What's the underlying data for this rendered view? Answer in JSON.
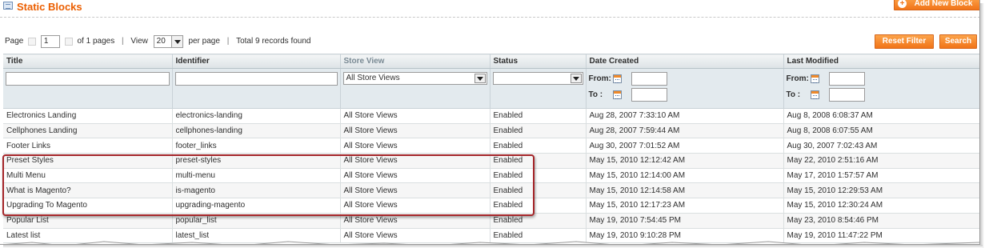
{
  "header": {
    "title": "Static Blocks",
    "add_button_label": "Add New Block"
  },
  "pager": {
    "page_label": "Page",
    "page_value": "1",
    "of_pages": "of 1 pages",
    "view_label": "View",
    "per_page_value": "20",
    "per_page_label": "per page",
    "total": "Total 9 records found"
  },
  "actions": {
    "reset_filter": "Reset Filter",
    "search": "Search"
  },
  "grid": {
    "columns": [
      "Title",
      "Identifier",
      "Store View",
      "Status",
      "Date Created",
      "Last Modified"
    ],
    "filters": {
      "store_view_value": "All Store Views",
      "from_label": "From:",
      "to_label": "To :"
    },
    "rows": [
      [
        "Electronics Landing",
        "electronics-landing",
        "All Store Views",
        "Enabled",
        "Aug 28, 2007 7:33:10 AM",
        "Aug 8, 2008 6:08:37 AM"
      ],
      [
        "Cellphones Landing",
        "cellphones-landing",
        "All Store Views",
        "Enabled",
        "Aug 28, 2007 7:59:44 AM",
        "Aug 8, 2008 6:07:55 AM"
      ],
      [
        "Footer Links",
        "footer_links",
        "All Store Views",
        "Enabled",
        "Aug 30, 2007 7:01:52 AM",
        "Aug 30, 2007 7:02:43 AM"
      ],
      [
        "Preset Styles",
        "preset-styles",
        "All Store Views",
        "Enabled",
        "May 15, 2010 12:12:42 AM",
        "May 22, 2010 2:51:16 AM"
      ],
      [
        "Multi Menu",
        "multi-menu",
        "All Store Views",
        "Enabled",
        "May 15, 2010 12:14:00 AM",
        "May 17, 2010 1:57:57 AM"
      ],
      [
        "What is Magento?",
        "is-magento",
        "All Store Views",
        "Enabled",
        "May 15, 2010 12:14:58 AM",
        "May 15, 2010 12:29:53 AM"
      ],
      [
        "Upgrading To Magento",
        "upgrading-magento",
        "All Store Views",
        "Enabled",
        "May 15, 2010 12:17:23 AM",
        "May 15, 2010 12:30:24 AM"
      ],
      [
        "Popular List",
        "popular_list",
        "All Store Views",
        "Enabled",
        "May 19, 2010 7:54:45 PM",
        "May 23, 2010 8:54:46 PM"
      ],
      [
        "Latest list",
        "latest_list",
        "All Store Views",
        "Enabled",
        "May 19, 2010 9:10:28 PM",
        "May 19, 2010 11:47:22 PM"
      ]
    ]
  },
  "colors": {
    "accent_orange": "#eb5e00",
    "button_orange": "#f17418",
    "header_bg": "#dde3e6",
    "filter_bg": "#e3eaee",
    "highlight_red": "#a5262a"
  },
  "icons": {
    "title": "grid-icon",
    "add": "plus-icon",
    "calendar": "calendar-icon"
  }
}
